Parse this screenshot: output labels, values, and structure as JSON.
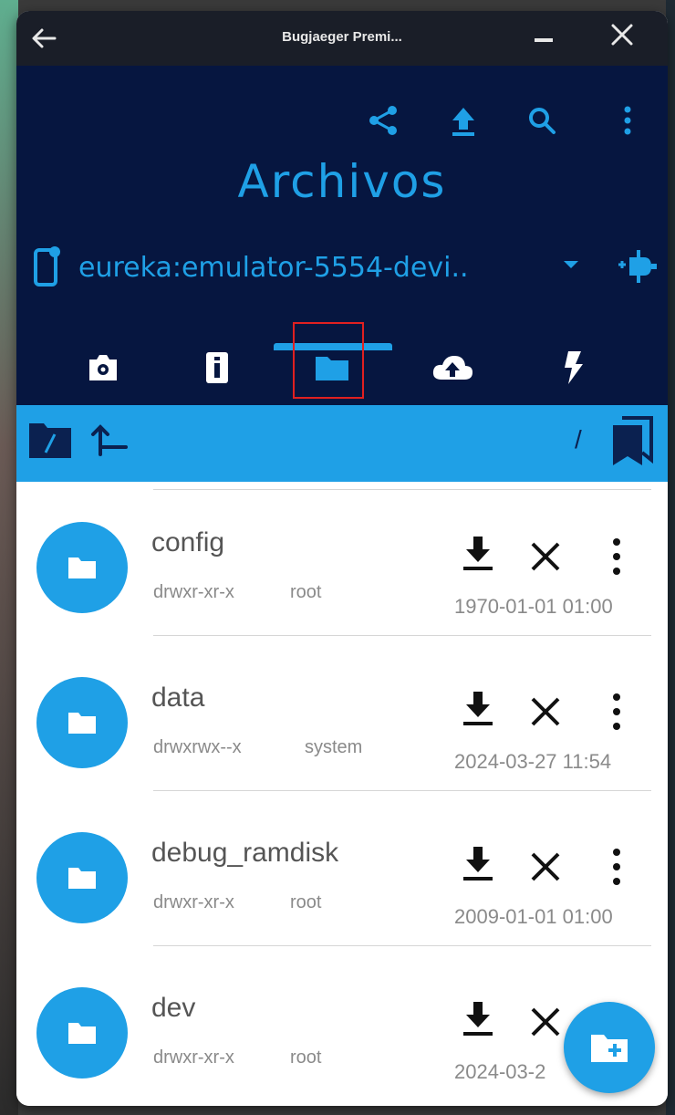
{
  "window": {
    "title": "Bugjaeger Premi..."
  },
  "header": {
    "app_title": "Archivos",
    "device_name": "eureka:emulator-5554-devi.."
  },
  "toolbar_icons": [
    "share-icon",
    "upload-icon",
    "search-icon",
    "more-vert-icon"
  ],
  "tabs": [
    {
      "icon": "screenshot-icon"
    },
    {
      "icon": "info-icon"
    },
    {
      "icon": "folder-icon",
      "selected": true
    },
    {
      "icon": "cloud-upload-icon"
    },
    {
      "icon": "flash-icon"
    }
  ],
  "path": {
    "current": "/"
  },
  "files": [
    {
      "name": "config",
      "permissions": "drwxr-xr-x",
      "owner": "root",
      "modified": "1970-01-01 01:00"
    },
    {
      "name": "data",
      "permissions": "drwxrwx--x",
      "owner": "system",
      "modified": "2024-03-27 11:54"
    },
    {
      "name": "debug_ramdisk",
      "permissions": "drwxr-xr-x",
      "owner": "root",
      "modified": "2009-01-01 01:00"
    },
    {
      "name": "dev",
      "permissions": "drwxr-xr-x",
      "owner": "root",
      "modified": "2024-03-2"
    }
  ],
  "colors": {
    "accent": "#1fa0e6",
    "header_bg": "#061640",
    "titlebar_bg": "#1a1e28"
  }
}
